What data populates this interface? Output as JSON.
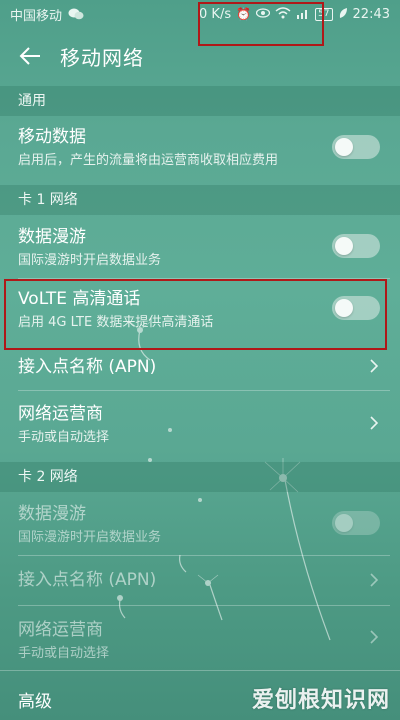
{
  "status_bar": {
    "carrier": "中国移动",
    "speed": "0 K/s",
    "battery": "57",
    "time": "22:43",
    "icons": [
      "wechat-icon",
      "alarm-icon",
      "eye-icon",
      "wifi-icon",
      "4g-signal-icon",
      "battery-icon",
      "leaf-icon"
    ]
  },
  "app_bar": {
    "title": "移动网络",
    "back_icon": "back-arrow-icon"
  },
  "sections": {
    "general": "通用",
    "sim1": "卡 1 网络",
    "sim2": "卡 2 网络",
    "advanced": "高级"
  },
  "rows": {
    "mobile_data": {
      "title": "移动数据",
      "subtitle": "启用后，产生的流量将由运营商收取相应费用",
      "toggle": "off"
    },
    "roaming1": {
      "title": "数据漫游",
      "subtitle": "国际漫游时开启数据业务",
      "toggle": "off"
    },
    "volte": {
      "title": "VoLTE 高清通话",
      "subtitle": "启用 4G LTE 数据来提供高清通话",
      "toggle": "off"
    },
    "apn1": {
      "title": "接入点名称 (APN)"
    },
    "carrier1": {
      "title": "网络运营商",
      "subtitle": "手动或自动选择"
    },
    "roaming2": {
      "title": "数据漫游",
      "subtitle": "国际漫游时开启数据业务",
      "toggle": "off",
      "disabled": true
    },
    "apn2": {
      "title": "接入点名称 (APN)",
      "disabled": true
    },
    "carrier2": {
      "title": "网络运营商",
      "subtitle": "手动或自动选择",
      "disabled": true
    }
  },
  "watermark": "爱刨根知识网",
  "colors": {
    "highlight": "#b01818",
    "background": "#5aa893"
  }
}
